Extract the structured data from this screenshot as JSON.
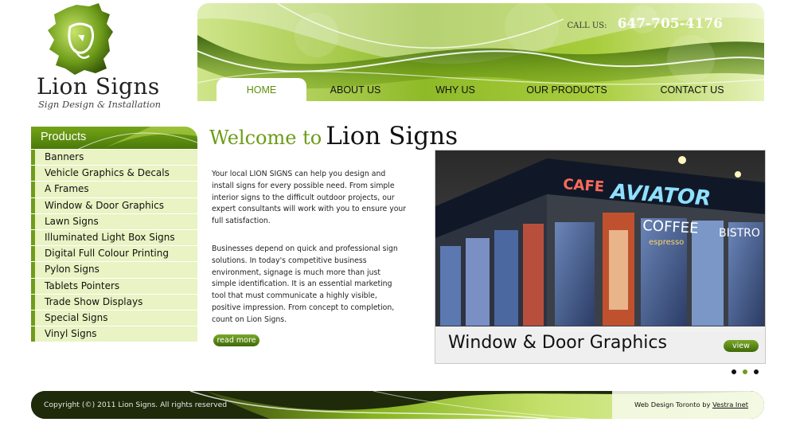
{
  "brand": {
    "name": "Lion Signs",
    "tagline": "Sign Design & Installation",
    "accent": "#6c9c16"
  },
  "header": {
    "call_label": "CALL US:",
    "phone": "647-705-4176"
  },
  "nav": [
    {
      "label": "HOME",
      "active": true
    },
    {
      "label": "ABOUT US",
      "active": false
    },
    {
      "label": "WHY US",
      "active": false
    },
    {
      "label": "OUR PRODUCTS",
      "active": false
    },
    {
      "label": "CONTACT US",
      "active": false
    }
  ],
  "sidebar": {
    "title": "Products",
    "items": [
      "Banners",
      "Vehicle Graphics & Decals",
      "A Frames",
      "Window & Door Graphics",
      "Lawn Signs",
      "Illuminated Light Box Signs",
      "Digital Full Colour Printing",
      "Pylon Signs",
      "Tablets Pointers",
      "Trade Show Displays",
      "Special Signs",
      "Vinyl Signs"
    ]
  },
  "main": {
    "welcome": "Welcome to",
    "welcome_brand": "Lion Signs",
    "para1": "Your local LION SIGNS can help you design and install signs for every possible need. From simple interior signs to the difficult outdoor projects, our expert consultants will work with you to ensure your full satisfaction.",
    "para2": "Businesses depend on quick and professional sign solutions. In today's competitive business environment, signage is much more than just simple identification. It is an essential marketing tool that must communicate a highly visible, positive impression. From concept to completion, count on Lion Signs.",
    "read_more": "read more"
  },
  "slider": {
    "caption": "Window & Door Graphics",
    "view_label": "view",
    "photo_signs": [
      "CAFE",
      "AVIATOR",
      "COFFEE",
      "BISTRO",
      "espresso"
    ],
    "slide_count": 3,
    "active_slide": 2
  },
  "footer": {
    "copyright": "Copyright (©) 2011 Lion Signs. All rights reserved",
    "credit_prefix": "Web Design Toronto by",
    "credit_link": "Vestra Inet"
  }
}
